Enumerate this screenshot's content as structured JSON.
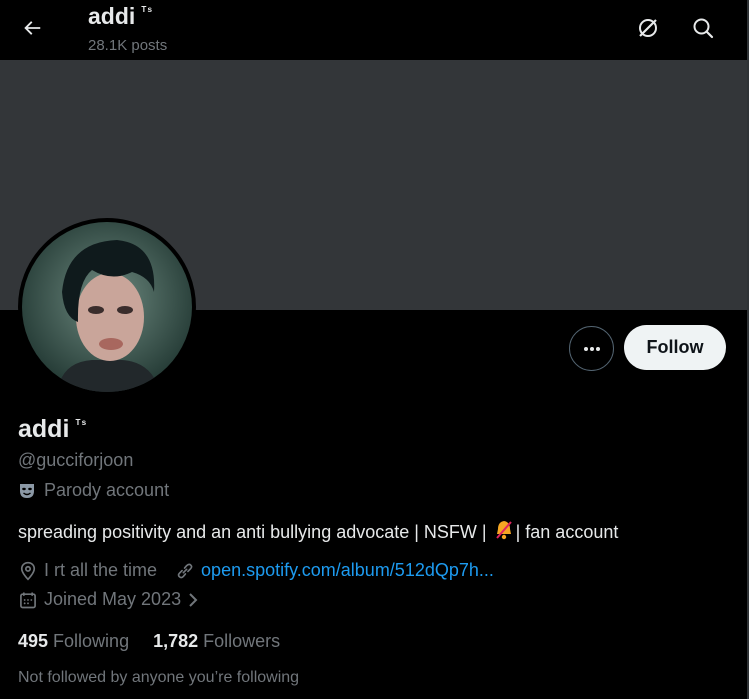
{
  "header": {
    "name": "addi",
    "name_suffix": "ᵀˢ",
    "posts": "28.1K posts"
  },
  "profile": {
    "display_name": "addi",
    "display_suffix": "ᵀˢ",
    "handle": "@gucciforjoon",
    "parody_label": "Parody account",
    "bio_before": "spreading positivity and an anti bullying advocate | NSFW | ",
    "bio_after": "| fan account",
    "location": "I rt all the time",
    "link": "open.spotify.com/album/512dQp7h...",
    "joined": "Joined May 2023",
    "following_count": "495",
    "following_label": "Following",
    "followers_count": "1,782",
    "followers_label": "Followers",
    "not_followed": "Not followed by anyone you’re following"
  },
  "actions": {
    "follow_label": "Follow"
  },
  "colors": {
    "background": "#000000",
    "banner": "#333639",
    "link": "#1d9bf0",
    "muted": "#71767b",
    "text": "#e7e9ea"
  },
  "icons": [
    "back-arrow-icon",
    "grok-icon",
    "search-icon",
    "more-icon",
    "parody-mask-icon",
    "location-icon",
    "link-icon",
    "calendar-icon",
    "chevron-right-icon",
    "bell-off-icon"
  ]
}
